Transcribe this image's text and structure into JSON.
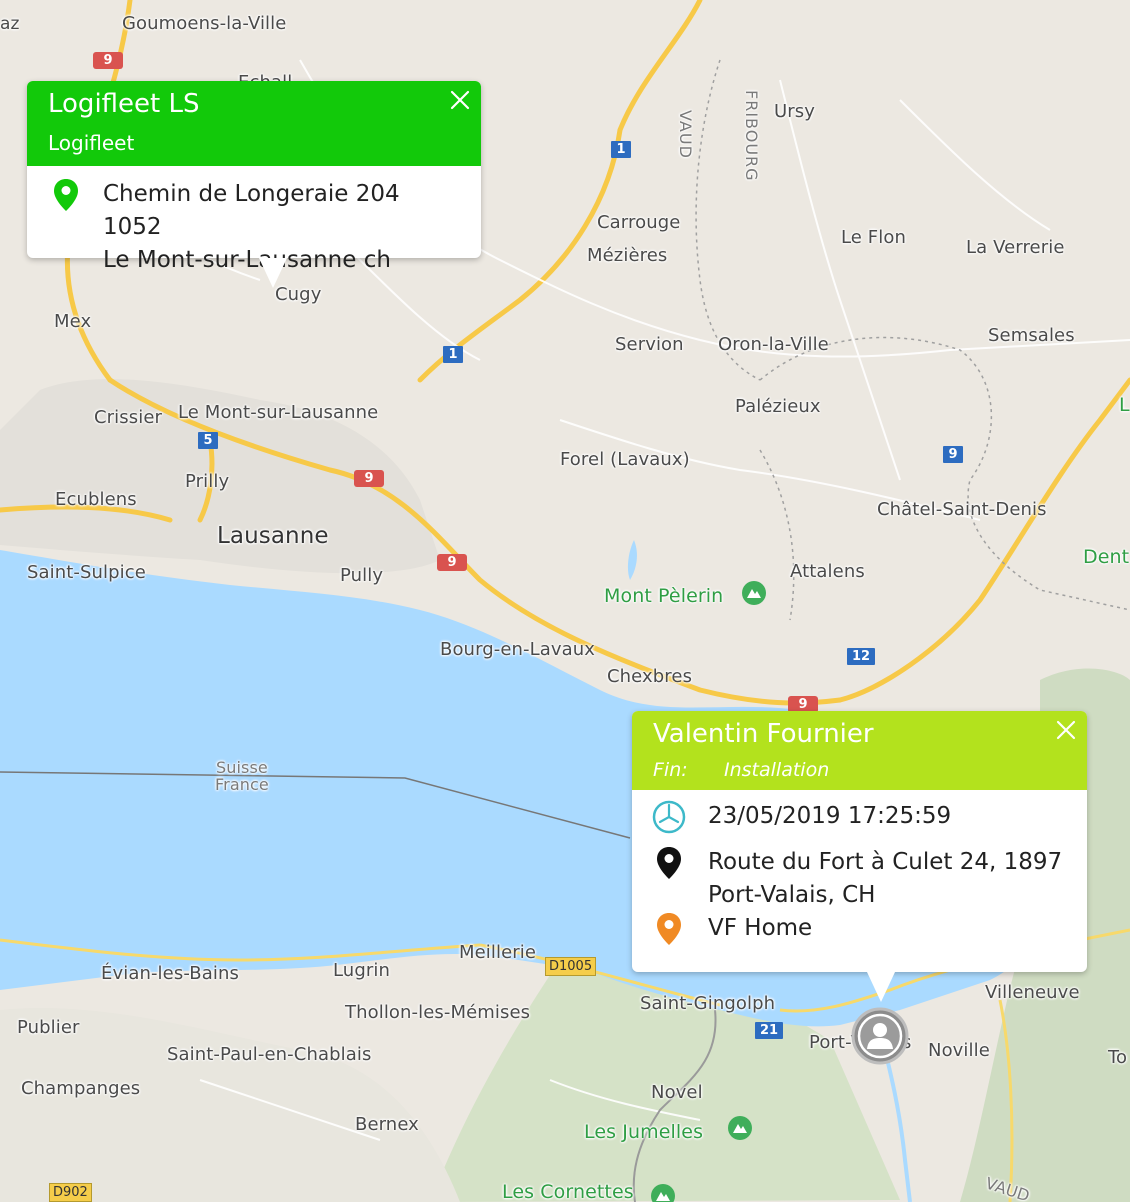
{
  "map": {
    "labels": [
      {
        "key": "az",
        "text": "az"
      },
      {
        "key": "goumoens",
        "text": "Goumoens-la-Ville"
      },
      {
        "key": "echallens",
        "text": "Echall"
      },
      {
        "key": "ursy",
        "text": "Ursy"
      },
      {
        "key": "carrouge",
        "text": "Carrouge"
      },
      {
        "key": "mezieres",
        "text": "Mézières"
      },
      {
        "key": "leflon",
        "text": "Le Flon"
      },
      {
        "key": "laverrerie",
        "text": "La Verrerie"
      },
      {
        "key": "cugy",
        "text": "Cugy"
      },
      {
        "key": "mex",
        "text": "Mex"
      },
      {
        "key": "servion",
        "text": "Servion"
      },
      {
        "key": "oron",
        "text": "Oron-la-Ville"
      },
      {
        "key": "semsales",
        "text": "Semsales"
      },
      {
        "key": "crissier",
        "text": "Crissier"
      },
      {
        "key": "montsurlausanne",
        "text": "Le Mont-sur-Lausanne"
      },
      {
        "key": "palezieux",
        "text": "Palézieux"
      },
      {
        "key": "prilly",
        "text": "Prilly"
      },
      {
        "key": "forel",
        "text": "Forel (Lavaux)"
      },
      {
        "key": "ecublens",
        "text": "Ecublens"
      },
      {
        "key": "chatelstdenis",
        "text": "Châtel-Saint-Denis"
      },
      {
        "key": "lausanne",
        "text": "Lausanne"
      },
      {
        "key": "stsulpice",
        "text": "Saint-Sulpice"
      },
      {
        "key": "pully",
        "text": "Pully"
      },
      {
        "key": "attalens",
        "text": "Attalens"
      },
      {
        "key": "bourg",
        "text": "Bourg-en-Lavaux"
      },
      {
        "key": "chexbres",
        "text": "Chexbres"
      },
      {
        "key": "meillerie",
        "text": "Meillerie"
      },
      {
        "key": "evian",
        "text": "Évian-les-Bains"
      },
      {
        "key": "lugrin",
        "text": "Lugrin"
      },
      {
        "key": "villeneuve",
        "text": "Villeneuve"
      },
      {
        "key": "publier",
        "text": "Publier"
      },
      {
        "key": "thollon",
        "text": "Thollon-les-Mémises"
      },
      {
        "key": "stgingolph",
        "text": "Saint-Gingolph"
      },
      {
        "key": "portvalais",
        "text": "Port-V"
      },
      {
        "key": "portvalais2",
        "text": "s"
      },
      {
        "key": "noville",
        "text": "Noville"
      },
      {
        "key": "stpaul",
        "text": "Saint-Paul-en-Chablais"
      },
      {
        "key": "champanges",
        "text": "Champanges"
      },
      {
        "key": "novel",
        "text": "Novel"
      },
      {
        "key": "bernex",
        "text": "Bernex"
      },
      {
        "key": "to",
        "text": "To"
      }
    ],
    "vertical_labels": [
      {
        "key": "vaud",
        "text": "VAUD"
      },
      {
        "key": "fribourg",
        "text": "FRIBOURG"
      }
    ],
    "border_label": {
      "line1": "Suisse",
      "line2": "France"
    },
    "vaud_south": "VAUD",
    "green_labels": [
      {
        "key": "montpelerin",
        "text": "Mont Pèlerin"
      },
      {
        "key": "jumelles",
        "text": "Les Jumelles"
      },
      {
        "key": "cornettes",
        "text": "Les Cornettes"
      },
      {
        "key": "dent",
        "text": "Dent"
      },
      {
        "key": "l",
        "text": "L"
      }
    ],
    "shields": [
      {
        "key": "s9a",
        "text": "9",
        "style": "red"
      },
      {
        "key": "s1a",
        "text": "1",
        "style": "blue"
      },
      {
        "key": "s1b",
        "text": "1",
        "style": "blue"
      },
      {
        "key": "s5",
        "text": "5",
        "style": "blue"
      },
      {
        "key": "s9b",
        "text": "9",
        "style": "red"
      },
      {
        "key": "s9c",
        "text": "9",
        "style": "red"
      },
      {
        "key": "s9d",
        "text": "9",
        "style": "blue"
      },
      {
        "key": "s12",
        "text": "12",
        "style": "blue"
      },
      {
        "key": "s9e",
        "text": "9",
        "style": "red"
      },
      {
        "key": "d1005",
        "text": "D1005",
        "style": "yellow"
      },
      {
        "key": "s21",
        "text": "21",
        "style": "blue"
      },
      {
        "key": "d902",
        "text": "D902",
        "style": "yellow"
      }
    ],
    "colors": {
      "water": "#aadaff",
      "land": "#ece8e1",
      "road": "#f7c948",
      "green_area": "#d9e8c4"
    }
  },
  "popup_logifleet": {
    "title": "Logifleet LS",
    "subtitle": "Logifleet",
    "address_line1": "Chemin de Longeraie 204 1052",
    "address_line2": "Le Mont-sur-Lausanne ch",
    "header_color": "#12c90a",
    "icon": "map-pin-icon",
    "close_icon": "close-icon"
  },
  "popup_driver": {
    "title": "Valentin Fournier",
    "status_label": "Fin:",
    "status_value": "Installation",
    "timestamp": "23/05/2019 17:25:59",
    "address_line1": "Route du Fort à Culet 24, 1897",
    "address_line2": "Port-Valais, CH",
    "place": "VF Home",
    "header_color": "#b3e21d",
    "icons": [
      "clock-icon",
      "map-pin-icon",
      "place-pin-icon"
    ],
    "close_icon": "close-icon"
  },
  "vehicle_marker": {
    "icon": "user-avatar-icon"
  }
}
